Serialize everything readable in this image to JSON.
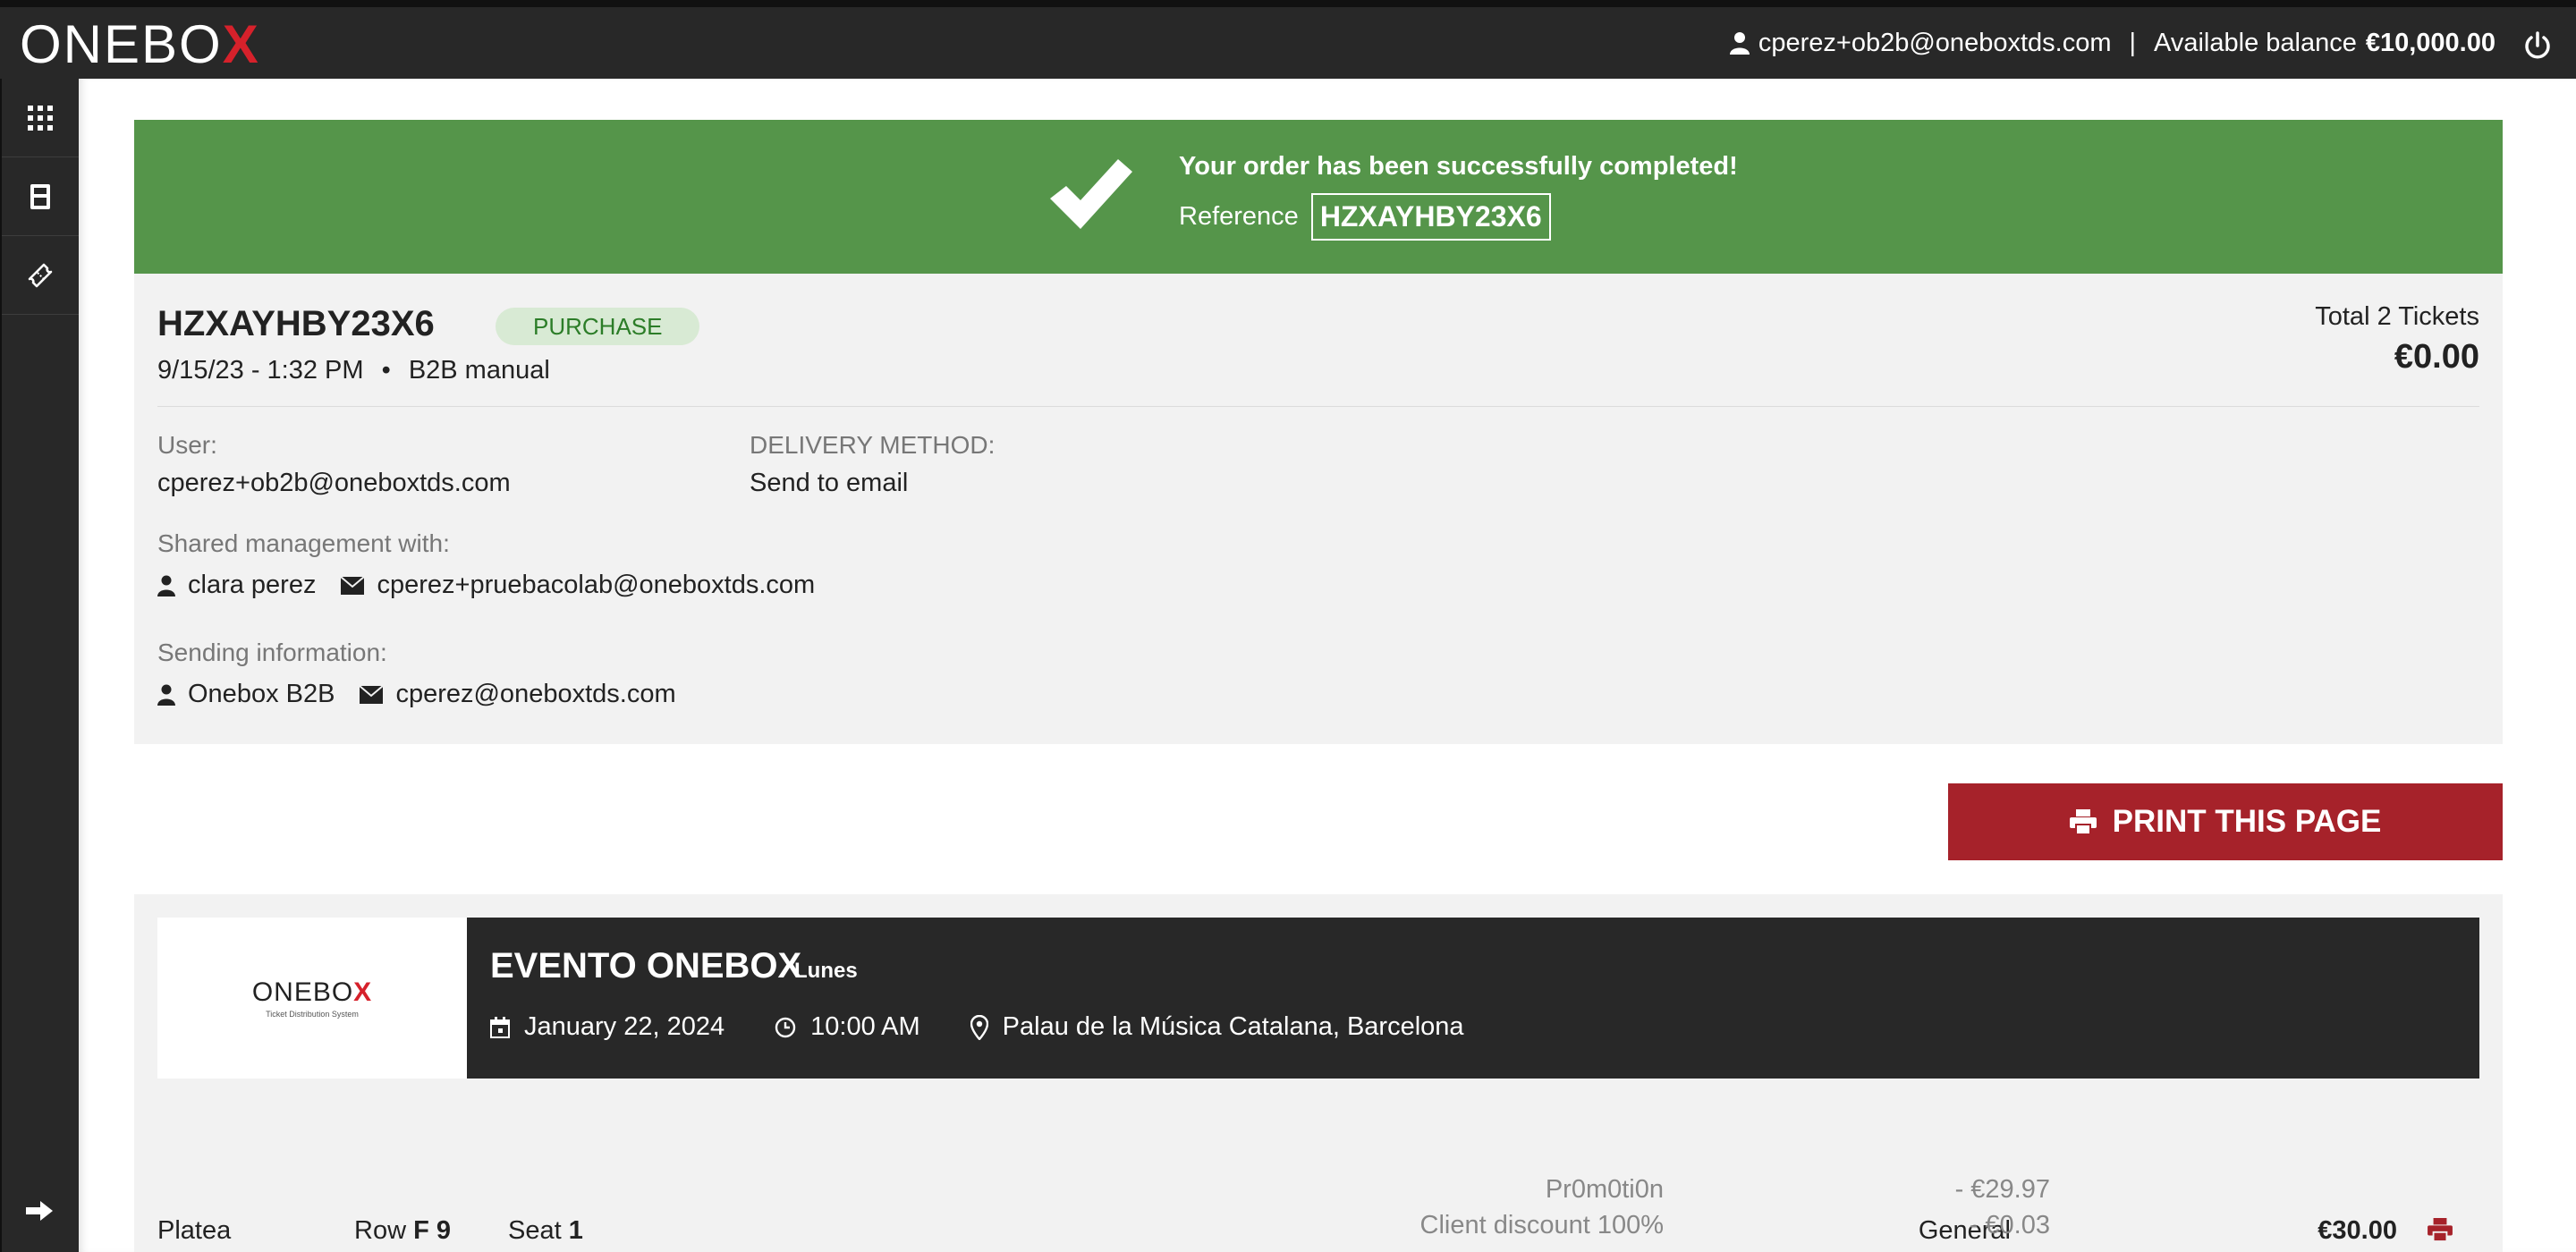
{
  "header": {
    "logo": "ONEBOX",
    "user_email": "cperez+ob2b@oneboxtds.com",
    "separator": "|",
    "balance_label": "Available balance",
    "balance_value": "€10,000.00"
  },
  "sidebar": {
    "items": [
      {
        "icon": "grid-icon"
      },
      {
        "icon": "calculator-icon"
      },
      {
        "icon": "ticket-icon"
      }
    ],
    "bottom_icon": "arrow-right-icon"
  },
  "banner": {
    "message": "Your order has been successfully completed!",
    "reference_label": "Reference",
    "reference_code": "HZXAYHBY23X6",
    "color": "#55954a"
  },
  "order": {
    "code": "HZXAYHBY23X6",
    "type_badge": "PURCHASE",
    "datetime": "9/15/23 - 1:32 PM",
    "bullet": "•",
    "channel": "B2B manual",
    "total_label": "Total 2 Tickets",
    "total_amount": "€0.00",
    "user_label": "User:",
    "user_value": "cperez+ob2b@oneboxtds.com",
    "delivery_label": "DELIVERY METHOD:",
    "delivery_value": "Send to email",
    "shared_label": "Shared management with:",
    "shared_name": "clara perez",
    "shared_email": "cperez+pruebacolab@oneboxtds.com",
    "sending_label": "Sending information:",
    "sending_name": "Onebox B2B",
    "sending_email": "cperez@oneboxtds.com"
  },
  "actions": {
    "print_label": "PRINT THIS PAGE",
    "print_color": "#a6222a"
  },
  "event": {
    "logo_text": "ONEBOX",
    "logo_tagline": "Ticket Distribution System",
    "title": "EVENTO ONEBOX",
    "day": "Lunes",
    "date": "January 22, 2024",
    "time": "10:00 AM",
    "venue": "Palau de la Música Catalana, Barcelona"
  },
  "ticket": {
    "sector": "Platea",
    "row_label": "Row",
    "row_value": "F 9",
    "seat_label": "Seat",
    "seat_value": "1",
    "lines": [
      {
        "label": "General",
        "value": "€30.00"
      },
      {
        "label": "Pr0m0ti0n",
        "value": "- €29.97"
      },
      {
        "label": "Client discount 100%",
        "value": "- €0.03"
      }
    ]
  }
}
